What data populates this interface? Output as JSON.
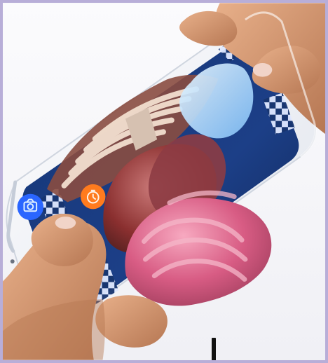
{
  "photo": {
    "subject": "phone-ar-anatomy",
    "colors": {
      "background": "#f3f3f7",
      "border": "#b8aed8",
      "phone": "#eef0f5",
      "screen_blue": "#1c3f87",
      "screen_dark": "#10244e",
      "anatomy_pink": "#d85c84",
      "anatomy_red": "#8a2f2f",
      "lung_blue": "#9fd1ff",
      "skin": "#d9a27b",
      "skin_shadow": "#b67753",
      "nail": "#f1d4c8",
      "button_blue": "#2a66ff",
      "button_orange": "#ff7b1e"
    }
  },
  "icons": {
    "camera": "camera-icon",
    "timer": "timer-icon",
    "grid": "grid-icon"
  }
}
